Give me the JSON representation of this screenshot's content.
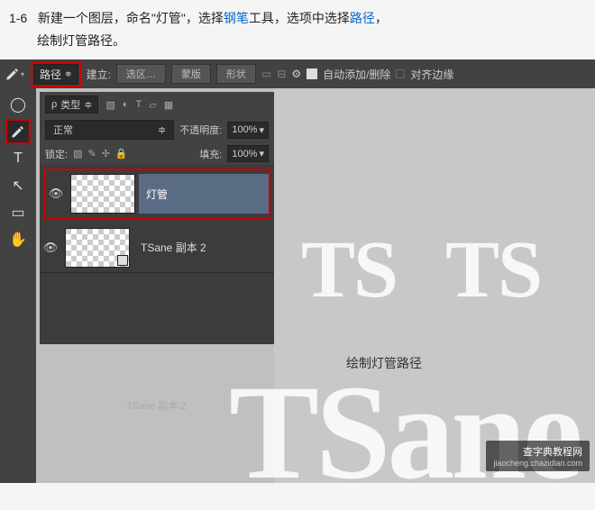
{
  "instruction": {
    "step": "1-6",
    "t1": "新建一个图层，命名\"灯管\"，选择",
    "link1": "钢笔",
    "t2": "工具，选项中选择",
    "link2": "路径",
    "t3": "，",
    "t4": "绘制灯管路径。"
  },
  "options_bar": {
    "mode": "路径",
    "build_label": "建立:",
    "btn_selection": "选区…",
    "btn_mask": "蒙版",
    "btn_shape": "形状",
    "auto_label": "自动添加/删除",
    "align_label": "对齐边缘"
  },
  "layers": {
    "filter_type": "类型",
    "blend_mode": "正常",
    "opacity_label": "不透明度:",
    "opacity_value": "100%",
    "lock_label": "锁定:",
    "fill_label": "填充:",
    "fill_value": "100%",
    "items": [
      {
        "name": "灯管"
      },
      {
        "name": "TSane 副本 2"
      }
    ],
    "reflection": "TSane 副本 2"
  },
  "canvas": {
    "ghost1": "TS",
    "ghost2": "TS",
    "ghost_big": "TSane",
    "caption": "绘制灯管路径"
  },
  "watermark": {
    "title": "查字典教程网",
    "url": "jiaocheng.chazidian.com"
  }
}
